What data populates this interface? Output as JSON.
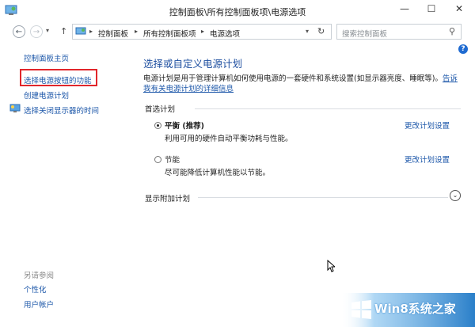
{
  "window": {
    "title": "控制面板\\所有控制面板项\\电源选项",
    "minimize_glyph": "—",
    "maximize_glyph": "☐",
    "close_glyph": "✕"
  },
  "nav": {
    "back_glyph": "←",
    "forward_glyph": "→",
    "history_glyph": "▾",
    "up_glyph": "↑",
    "breadcrumbs": [
      "控制面板",
      "所有控制面板项",
      "电源选项"
    ],
    "sep_glyph": "▸",
    "dropdown_glyph": "▾",
    "refresh_glyph": "↻",
    "search_placeholder": "搜索控制面板",
    "search_glyph": "⚲"
  },
  "help_glyph": "?",
  "sidebar": {
    "home": "控制面板主页",
    "items": [
      "选择电源按钮的功能",
      "创建电源计划",
      "选择关闭显示器的时间"
    ],
    "see_also_title": "另请参阅",
    "see_also": [
      "个性化",
      "用户帐户"
    ]
  },
  "main": {
    "title": "选择或自定义电源计划",
    "description": "电源计划是用于管理计算机如何使用电源的一套硬件和系统设置(如显示器亮度、睡眠等)。",
    "description_link": "告诉我有关电源计划的详细信息",
    "preferred_label": "首选计划",
    "plans": [
      {
        "name": "平衡",
        "suffix": " (推荐)",
        "description": "利用可用的硬件自动平衡功耗与性能。",
        "selected": true,
        "change": "更改计划设置"
      },
      {
        "name": "节能",
        "suffix": "",
        "description": "尽可能降低计算机性能以节能。",
        "selected": false,
        "change": "更改计划设置"
      }
    ],
    "more_plans": "显示附加计划",
    "expand_glyph": "⌄"
  },
  "watermark": {
    "text": "Win8系统之家",
    "accent": "#2a7fc9"
  }
}
